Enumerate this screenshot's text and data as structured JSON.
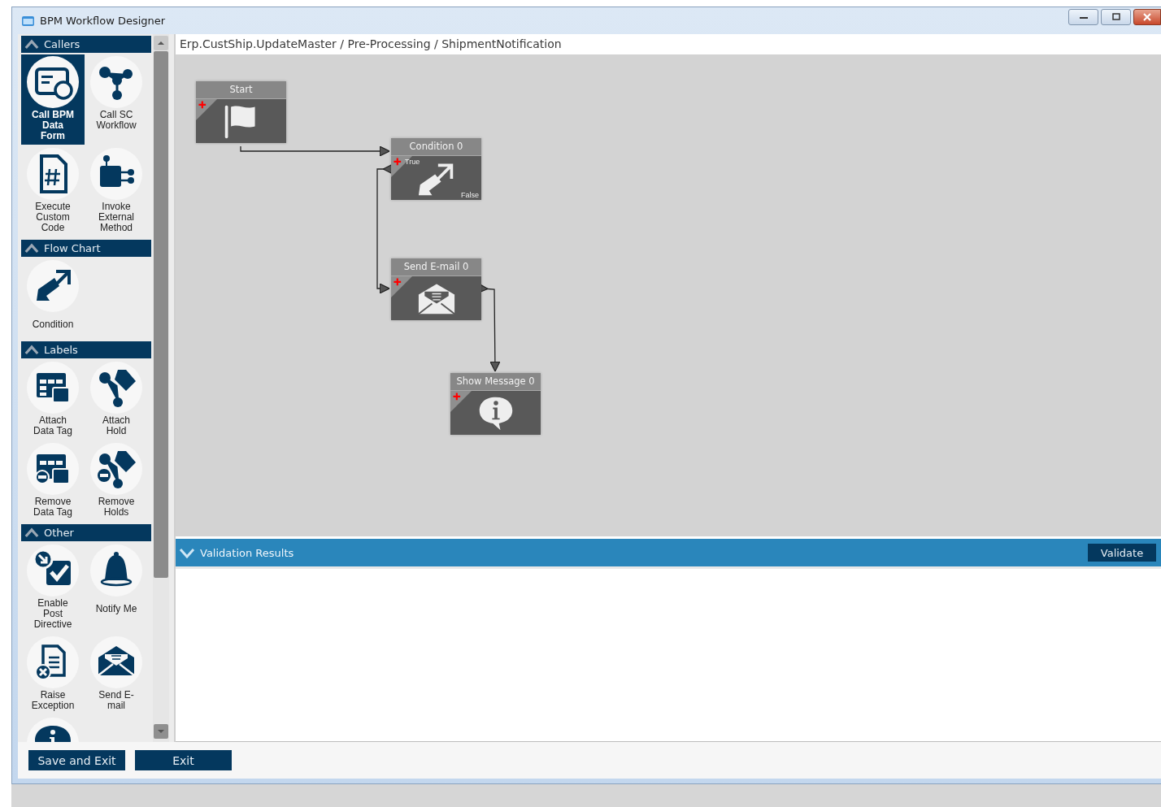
{
  "window": {
    "title": "BPM Workflow Designer"
  },
  "palette": {
    "sections": [
      {
        "title": "Callers",
        "expanded": true,
        "items": [
          {
            "label": "Call BPM\nData\nForm",
            "selected": true
          },
          {
            "label": "Call SC\nWorkflow",
            "selected": false
          },
          {
            "label": "Execute\nCustom\nCode",
            "selected": false
          },
          {
            "label": "Invoke\nExternal\nMethod",
            "selected": false
          }
        ]
      },
      {
        "title": "Flow Chart",
        "expanded": true,
        "items": [
          {
            "label": "Condition",
            "selected": false
          }
        ]
      },
      {
        "title": "Labels",
        "expanded": true,
        "items": [
          {
            "label": "Attach\nData Tag",
            "selected": false
          },
          {
            "label": "Attach\nHold",
            "selected": false
          },
          {
            "label": "Remove\nData Tag",
            "selected": false
          },
          {
            "label": "Remove\nHolds",
            "selected": false
          }
        ]
      },
      {
        "title": "Other",
        "expanded": true,
        "items": [
          {
            "label": "Enable\nPost\nDirective",
            "selected": false
          },
          {
            "label": "Notify Me",
            "selected": false
          },
          {
            "label": "Raise\nException",
            "selected": false
          },
          {
            "label": "Send E-\nmail",
            "selected": false
          },
          {
            "selected": false
          }
        ]
      }
    ]
  },
  "breadcrumb": "Erp.CustShip.UpdateMaster / Pre-Processing / ShipmentNotification",
  "canvas": {
    "nodes": [
      {
        "kind": "start",
        "title": "Start"
      },
      {
        "kind": "condition",
        "title": "Condition 0",
        "true_label": "True",
        "false_label": "False"
      },
      {
        "kind": "email",
        "title": "Send E-mail 0"
      },
      {
        "kind": "message",
        "title": "Show Message 0"
      }
    ]
  },
  "validation": {
    "title": "Validation Results",
    "expanded": true,
    "button": "Validate"
  },
  "buttons": [
    "Save and Exit",
    "Exit"
  ]
}
